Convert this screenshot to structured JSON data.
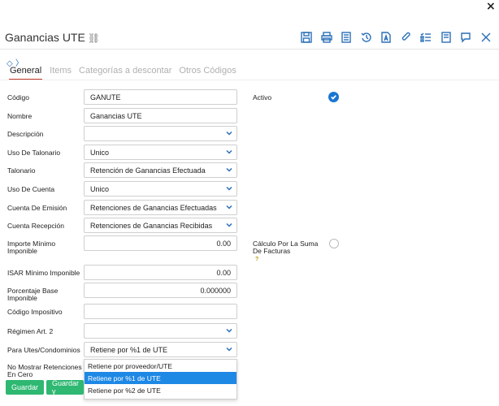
{
  "window": {
    "close_symbol": "×"
  },
  "header": {
    "title": "Ganancias UTE"
  },
  "toolbar": {
    "icons": [
      "save-icon",
      "print-icon",
      "document-icon",
      "history-icon",
      "pdf-icon",
      "attach-icon",
      "list-icon",
      "notes-icon",
      "comment-icon",
      "close-icon"
    ]
  },
  "small_links": "◇ 〉",
  "tabs": [
    "General",
    "Items",
    "Categorías a descontar",
    "Otros Códigos"
  ],
  "form": {
    "codigo": {
      "label": "Código",
      "value": "GANUTE"
    },
    "nombre": {
      "label": "Nombre",
      "value": "Ganancias UTE"
    },
    "descripcion": {
      "label": "Descripción",
      "value": ""
    },
    "uso_talonario": {
      "label": "Uso De Talonario",
      "value": "Unico"
    },
    "talonario": {
      "label": "Talonario",
      "value": "Retención de Ganancias Efectuada"
    },
    "uso_cuenta": {
      "label": "Uso De Cuenta",
      "value": "Unico"
    },
    "cuenta_emision": {
      "label": "Cuenta De Emisión",
      "value": "Retenciones de Ganancias Efectuadas"
    },
    "cuenta_recepcion": {
      "label": "Cuenta Recepción",
      "value": "Retenciones de Ganancias Recibidas"
    },
    "importe_minimo": {
      "label": "Importe Mínimo Imponible",
      "value": "0.00"
    },
    "isar_minimo": {
      "label": "ISAR Mínimo Imponible",
      "value": "0.00"
    },
    "porcentaje_base": {
      "label": "Porcentaje Base Imponible",
      "value": "0.000000"
    },
    "codigo_impositivo": {
      "label": "Código Impositivo",
      "value": ""
    },
    "regimen": {
      "label": "Régimen Art. 2",
      "value": ""
    },
    "para_utes": {
      "label": "Para Utes/Condominios",
      "value": "Retiene por %1 de UTE"
    },
    "no_mostrar": {
      "label": "No Mostrar Retenciones En Cero"
    },
    "activo": {
      "label": "Activo",
      "checked": true
    },
    "calculo": {
      "label": "Cálculo Por La Suma De Facturas",
      "checked": false,
      "help": "?"
    }
  },
  "dropdown_options": [
    "Retiene por proveedor/UTE",
    "Retiene por %1 de UTE",
    "Retiene por %2 de UTE"
  ],
  "dropdown_selected": "Retiene por %1 de UTE",
  "buttons": {
    "guardar": "Guardar",
    "guardar_y": "Guardar y"
  },
  "colors": {
    "accent": "#2a6fb8",
    "tab_active": "#c0392b",
    "button": "#2eb872",
    "selected": "#1e88e5"
  }
}
